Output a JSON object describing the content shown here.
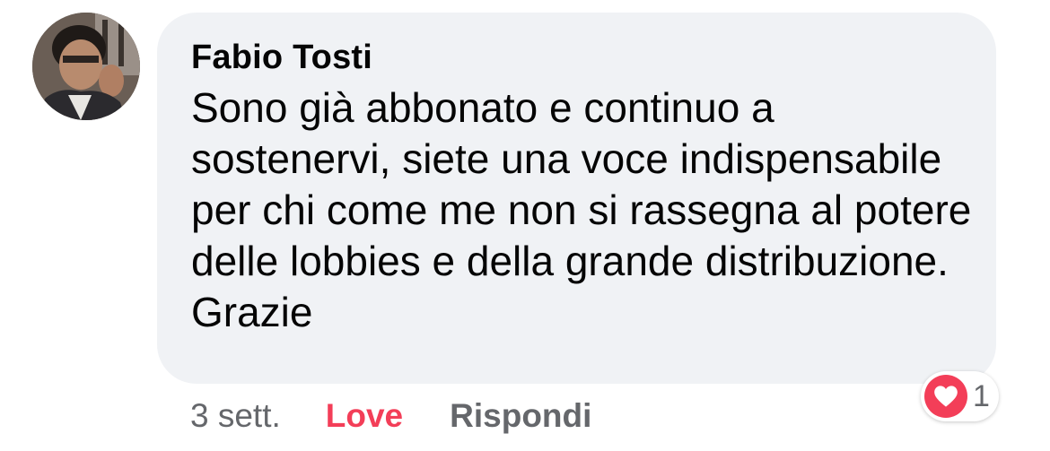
{
  "comment": {
    "author": "Fabio Tosti",
    "text": "Sono già abbonato e continuo a sostenervi, siete una voce indispensabile per chi come me non si rassegna al potere delle lobbies e della grande distribuzione. Grazie",
    "time": "3 sett.",
    "actions": {
      "love_label": "Love",
      "reply_label": "Rispondi"
    },
    "reactions": {
      "icon": "heart-icon",
      "count": "1"
    }
  },
  "colors": {
    "bubble_background": "#f0f2f5",
    "love_accent": "#f33e58",
    "secondary_text": "#65676b",
    "primary_text": "#050505"
  }
}
